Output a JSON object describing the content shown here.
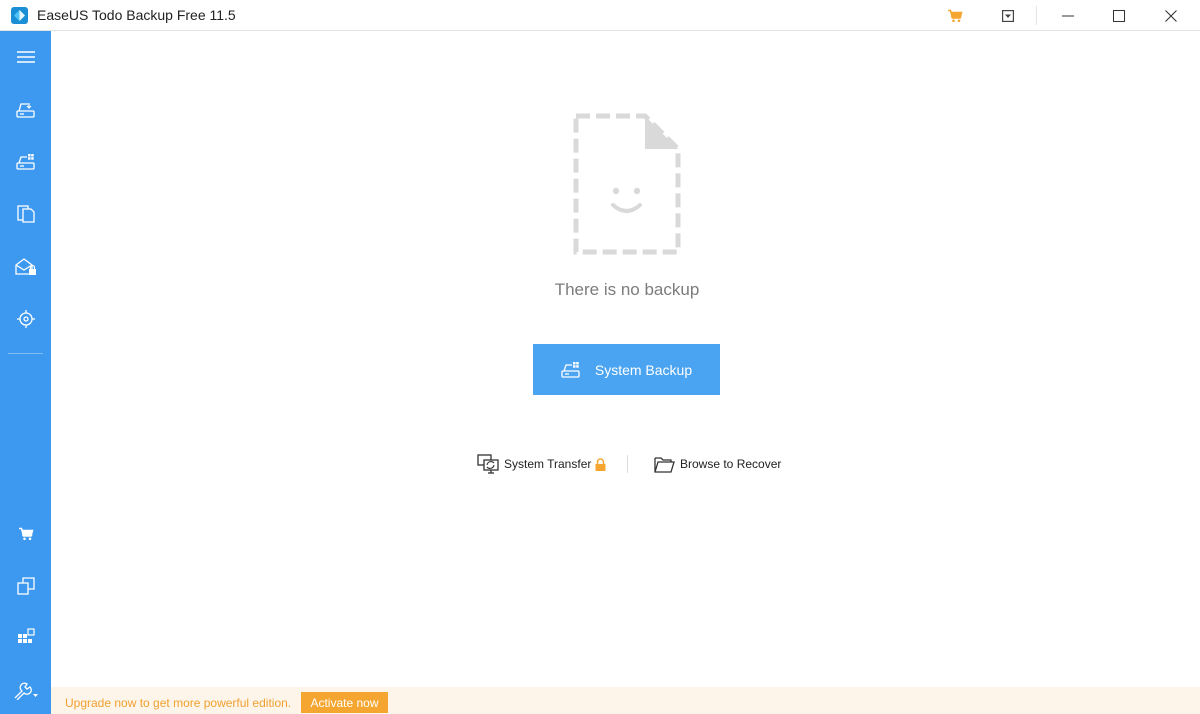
{
  "window": {
    "title": "EaseUS Todo Backup Free 11.5"
  },
  "titlebar": {
    "icons": [
      "app-logo-icon",
      "cart-icon",
      "dropdown-menu-icon",
      "minimize-icon",
      "maximize-icon",
      "close-icon"
    ]
  },
  "sidebar": {
    "top_items": [
      {
        "name": "menu",
        "icon": "hamburger-icon"
      },
      {
        "name": "disk-backup",
        "icon": "disk-backup-icon"
      },
      {
        "name": "system-backup",
        "icon": "system-backup-icon"
      },
      {
        "name": "file-backup",
        "icon": "file-backup-icon"
      },
      {
        "name": "mail-backup",
        "icon": "mail-backup-icon"
      },
      {
        "name": "smart-backup",
        "icon": "smart-backup-icon"
      }
    ],
    "bottom_items": [
      {
        "name": "store",
        "icon": "cart-icon"
      },
      {
        "name": "clone",
        "icon": "clone-icon"
      },
      {
        "name": "apps",
        "icon": "apps-icon"
      },
      {
        "name": "tools",
        "icon": "wrench-icon"
      }
    ]
  },
  "main": {
    "empty_message": "There is no backup",
    "primary_button": "System Backup",
    "links": {
      "system_transfer": "System Transfer",
      "browse_recover": "Browse to Recover"
    }
  },
  "footer": {
    "upgrade_text": "Upgrade now to get more powerful edition.",
    "activate_label": "Activate now"
  },
  "colors": {
    "sidebar": "#3d99ef",
    "primary_button": "#4ba4f1",
    "accent_orange": "#f5a630",
    "upgrade_bar_bg": "#fdf5ea"
  }
}
